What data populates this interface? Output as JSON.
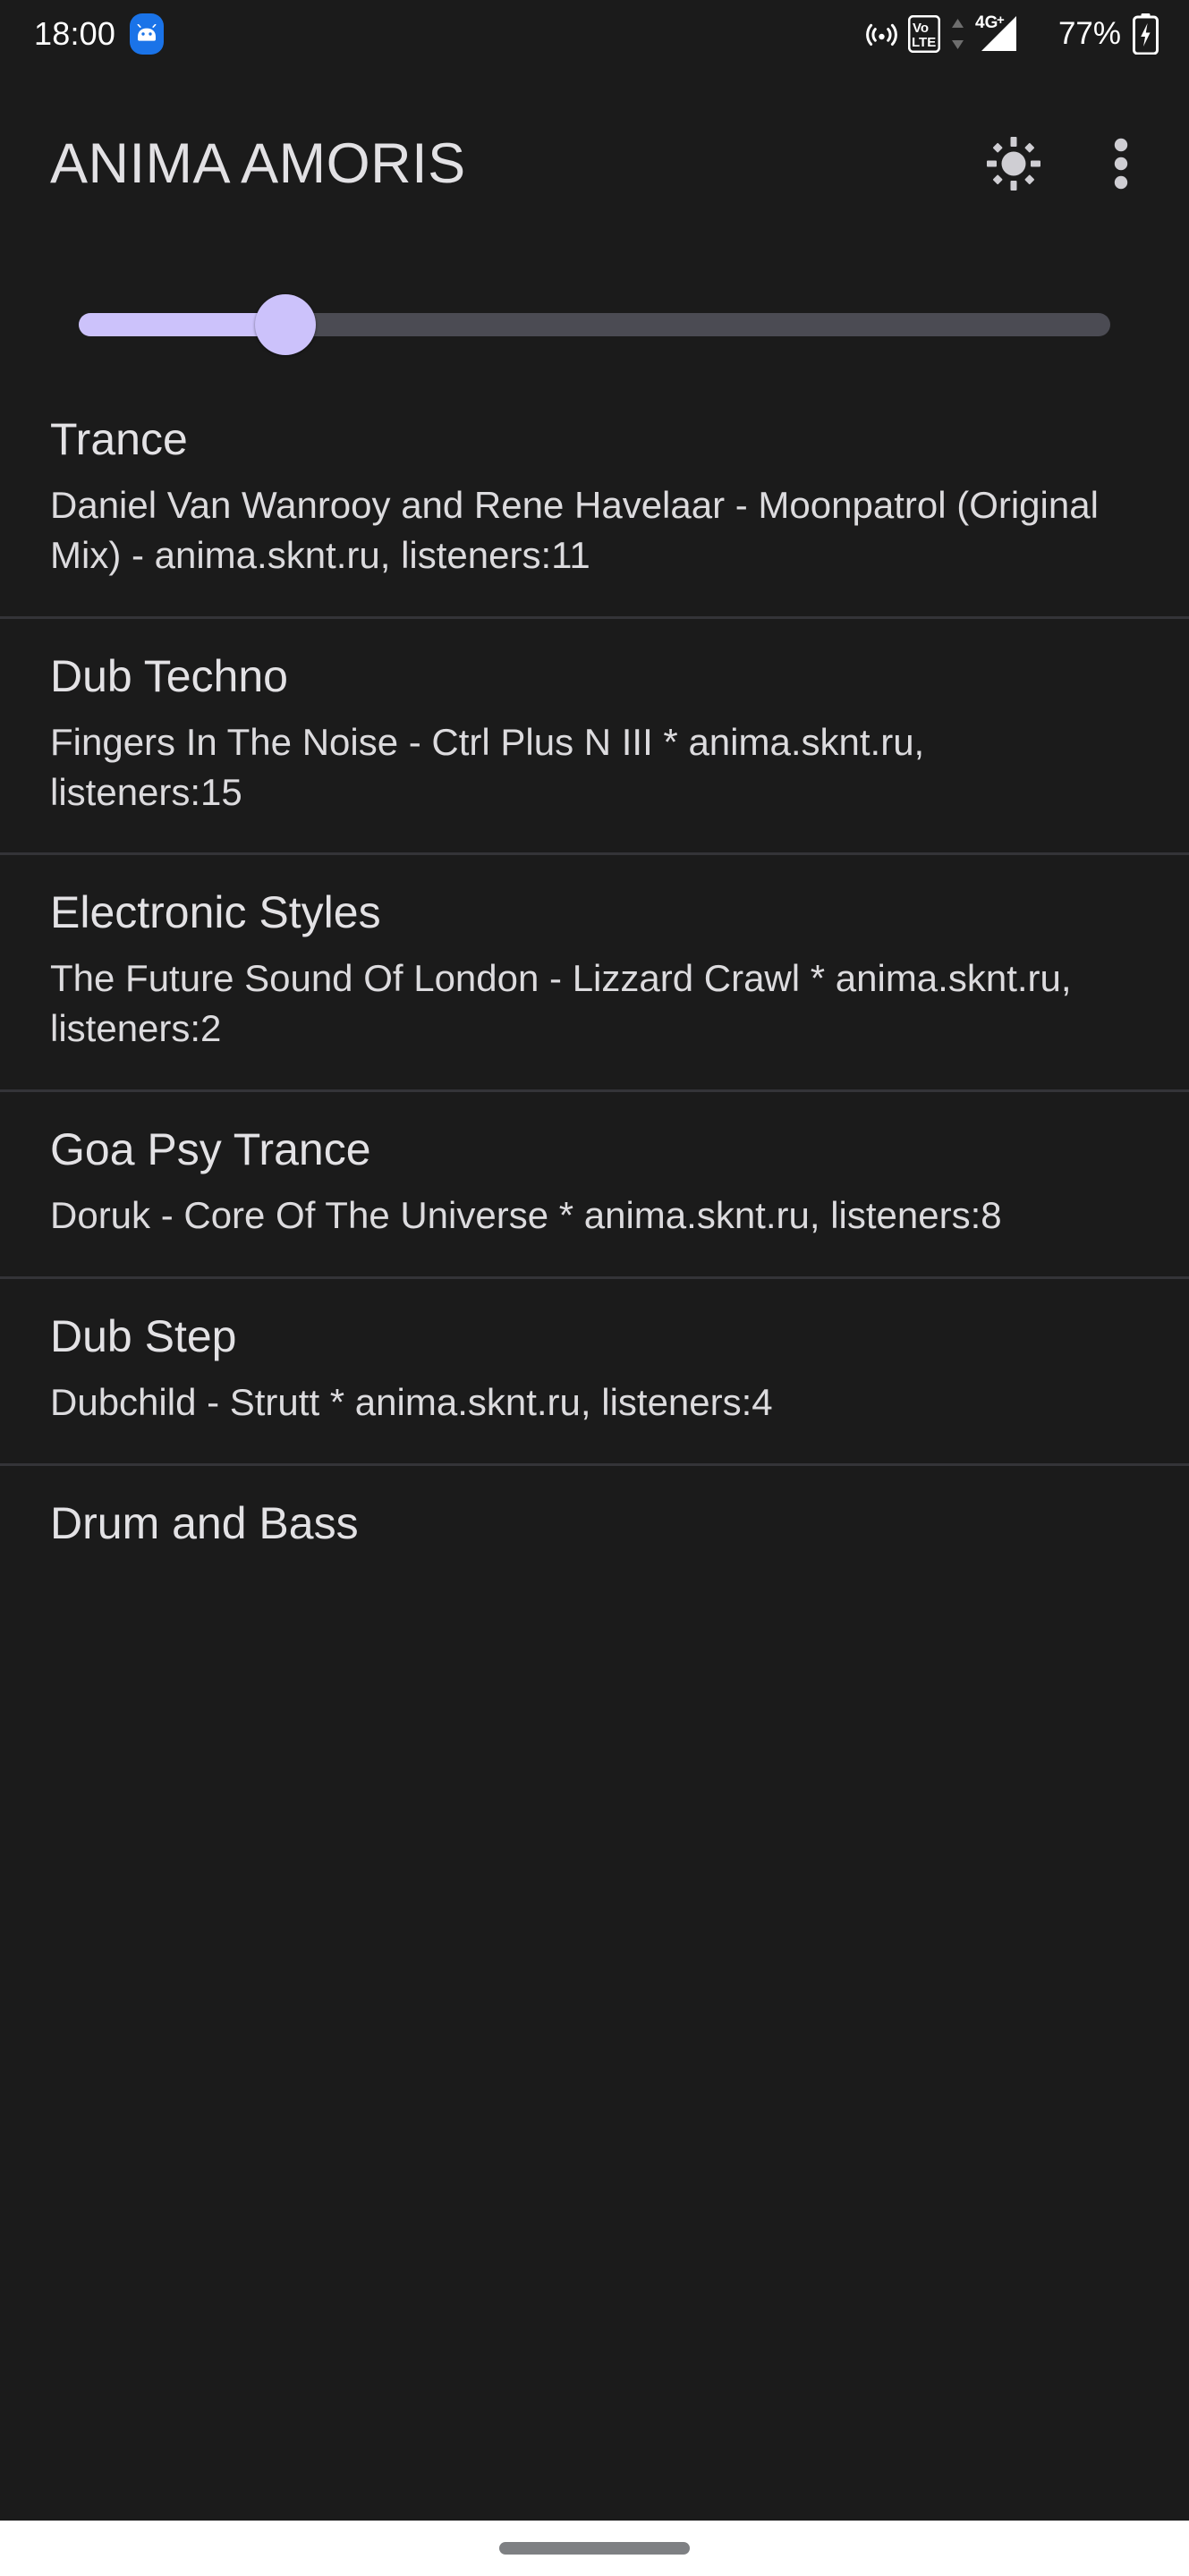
{
  "statusbar": {
    "time": "18:00",
    "battery_percent": "77%",
    "network_type": "4G+",
    "volte_label_top": "Vo",
    "volte_label_bottom": "LTE",
    "icons": {
      "android_badge": "android-head-icon",
      "cast": "cast-screen-icon",
      "volte": "volte-icon",
      "data_arrows": "data-transfer-icon",
      "signal": "signal-bars-icon",
      "battery": "battery-charging-icon"
    }
  },
  "appbar": {
    "title": "ANIMA AMORIS",
    "brightness_icon": "brightness-sun-icon",
    "overflow_icon": "overflow-menu-icon"
  },
  "slider": {
    "name": "volume-slider",
    "value_percent": 20,
    "fill_color": "#ccc2fb",
    "track_color": "#4b4b53"
  },
  "stations": [
    {
      "title": "Trance",
      "subtitle": "Daniel Van Wanrooy and Rene Havelaar - Moonpatrol (Original Mix) - anima.sknt.ru, listeners:11"
    },
    {
      "title": "Dub Techno",
      "subtitle": "Fingers In The Noise - Ctrl Plus N III * anima.sknt.ru, listeners:15"
    },
    {
      "title": "Electronic Styles",
      "subtitle": "The Future Sound Of London - Lizzard Crawl * anima.sknt.ru, listeners:2"
    },
    {
      "title": "Goa Psy Trance",
      "subtitle": "Doruk - Core Of The Universe * anima.sknt.ru, listeners:8"
    },
    {
      "title": "Dub Step",
      "subtitle": "Dubchild - Strutt * anima.sknt.ru, listeners:4"
    },
    {
      "title": "Drum and Bass",
      "subtitle": ""
    }
  ],
  "navbar": {
    "handle": "gesture-home-handle"
  }
}
